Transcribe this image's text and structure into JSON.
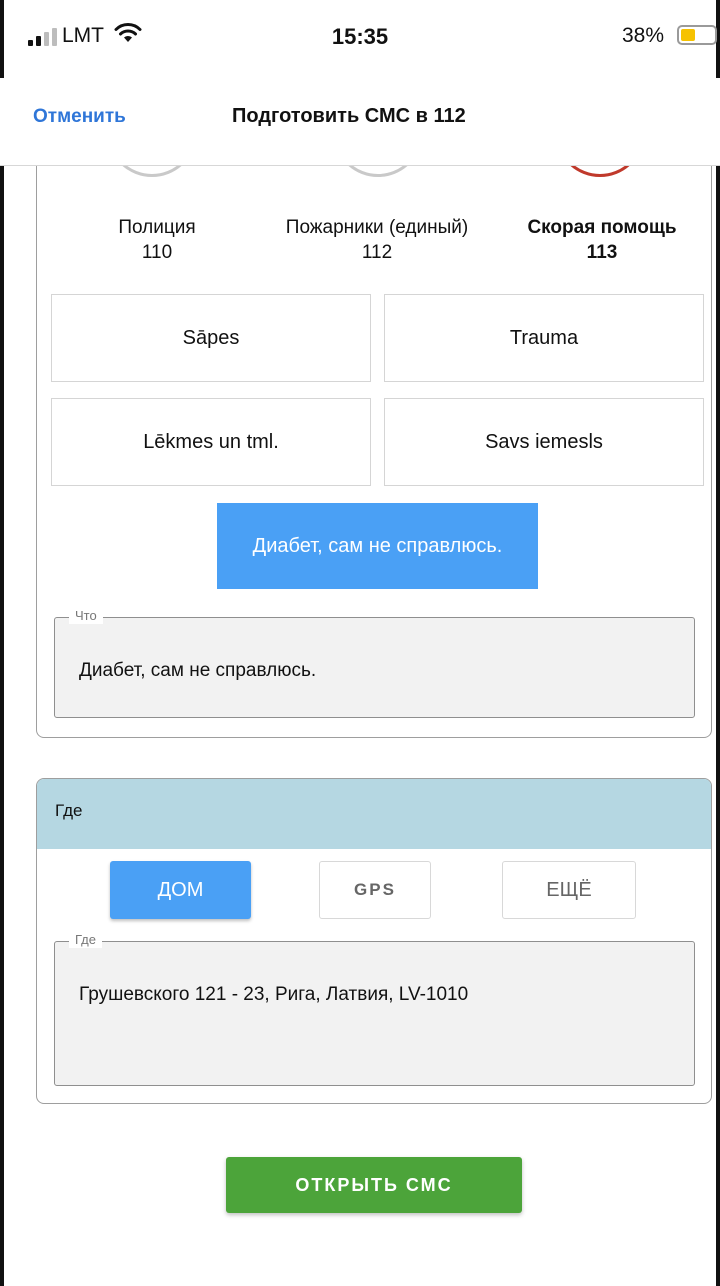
{
  "status": {
    "carrier": "LMT",
    "time": "15:35",
    "battery_percent": "38%",
    "battery_level": 0.38,
    "battery_color": "#f6c200"
  },
  "nav": {
    "cancel": "Отменить",
    "title": "Подготовить СМС в 112"
  },
  "services": [
    {
      "name": "Полиция",
      "number": "110",
      "icon": "shield-icon"
    },
    {
      "name": "Пожарники (единый)",
      "number": "112",
      "icon": "fire-icon"
    },
    {
      "name": "Скорая помощь",
      "number": "113",
      "icon": "ambulance-icon",
      "selected": true
    }
  ],
  "reasons": [
    "Sāpes",
    "Trauma",
    "Lēkmes un tml.",
    "Savs iemesls"
  ],
  "selected_reason": "Диабет, сам не справлюсь.",
  "what_field": {
    "label": "Что",
    "value": "Диабет, сам не справлюсь."
  },
  "where": {
    "header": "Где",
    "tabs": [
      "ДОМ",
      "GPS",
      "ЕЩЁ"
    ],
    "active_tab": "ДОМ",
    "field_label": "Где",
    "field_value": "Грушевского 121 - 23, Рига, Латвия, LV-1010"
  },
  "open_sms_label": "ОТКРЫТЬ СМС",
  "colors": {
    "accent_blue": "#4aa0f5",
    "link_blue": "#2f76d8",
    "primary_green": "#4ca43a",
    "ambulance_red": "#c0392b",
    "where_header_bg": "#b5d7e2"
  }
}
